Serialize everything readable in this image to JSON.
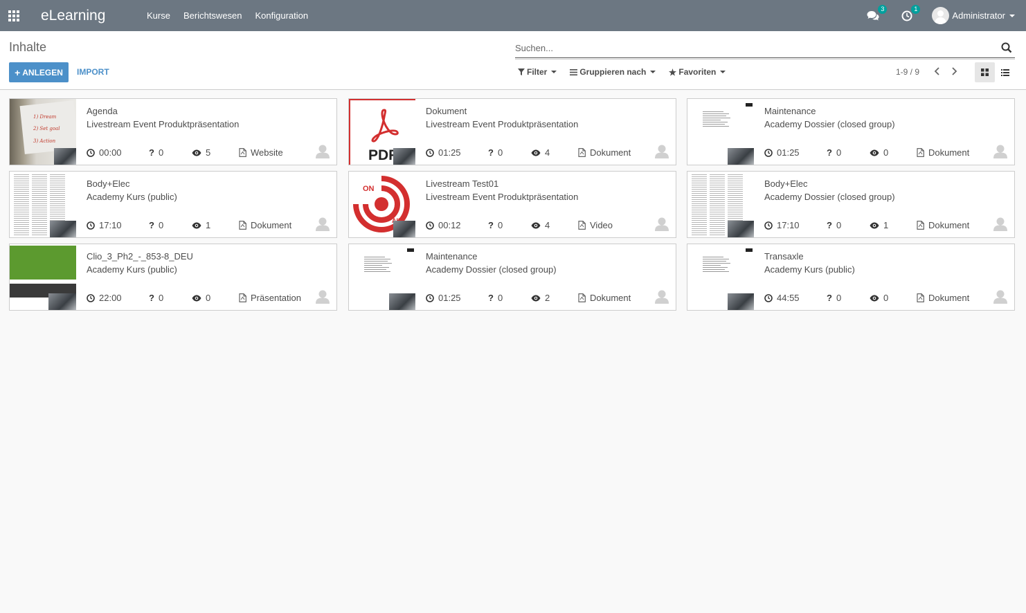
{
  "navbar": {
    "brand": "eLearning",
    "menu": [
      "Kurse",
      "Berichtswesen",
      "Konfiguration"
    ],
    "messages_count": "3",
    "activities_count": "1",
    "user_name": "Administrator"
  },
  "control": {
    "breadcrumb": "Inhalte",
    "create_label": "ANLEGEN",
    "import_label": "IMPORT",
    "search_placeholder": "Suchen...",
    "filter_label": "Filter",
    "group_label": "Gruppieren nach",
    "favorites_label": "Favoriten",
    "pager": "1-9 / 9"
  },
  "cards": [
    {
      "title": "Agenda",
      "subtitle": "Livestream Event Produktpräsentation",
      "duration": "00:00",
      "questions": "0",
      "views": "5",
      "type": "Website",
      "type_icon": "globe-doc-icon",
      "thumbnail": "dream-notebook"
    },
    {
      "title": "Dokument",
      "subtitle": "Livestream Event Produktpräsentation",
      "duration": "01:25",
      "questions": "0",
      "views": "4",
      "type": "Dokument",
      "type_icon": "pdf-file-icon",
      "thumbnail": "pdf-logo"
    },
    {
      "title": "Maintenance",
      "subtitle": "Academy Dossier (closed group)",
      "duration": "01:25",
      "questions": "0",
      "views": "0",
      "type": "Dokument",
      "type_icon": "pdf-file-icon",
      "thumbnail": "document-page"
    },
    {
      "title": "Body+Elec",
      "subtitle": "Academy Kurs (public)",
      "duration": "17:10",
      "questions": "0",
      "views": "1",
      "type": "Dokument",
      "type_icon": "pdf-file-icon",
      "thumbnail": "dense-text"
    },
    {
      "title": "Livestream Test01",
      "subtitle": "Livestream Event Produktpräsentation",
      "duration": "00:12",
      "questions": "0",
      "views": "4",
      "type": "Video",
      "type_icon": "video-file-icon",
      "thumbnail": "on-air"
    },
    {
      "title": "Body+Elec",
      "subtitle": "Academy Dossier (closed group)",
      "duration": "17:10",
      "questions": "0",
      "views": "1",
      "type": "Dokument",
      "type_icon": "pdf-file-icon",
      "thumbnail": "dense-text"
    },
    {
      "title": "Clio_3_Ph2_-_853-8_DEU",
      "subtitle": "Academy Kurs (public)",
      "duration": "22:00",
      "questions": "0",
      "views": "0",
      "type": "Präsentation",
      "type_icon": "presentation-file-icon",
      "thumbnail": "green-slide"
    },
    {
      "title": "Maintenance",
      "subtitle": "Academy Dossier (closed group)",
      "duration": "01:25",
      "questions": "0",
      "views": "2",
      "type": "Dokument",
      "type_icon": "pdf-file-icon",
      "thumbnail": "document-page"
    },
    {
      "title": "Transaxle",
      "subtitle": "Academy Kurs (public)",
      "duration": "44:55",
      "questions": "0",
      "views": "0",
      "type": "Dokument",
      "type_icon": "pdf-file-icon",
      "thumbnail": "document-page"
    }
  ],
  "colors": {
    "navbar": "#6c7782",
    "primary": "#4c90c9",
    "badge": "#00a09d",
    "pdf_red": "#d32f2f"
  }
}
